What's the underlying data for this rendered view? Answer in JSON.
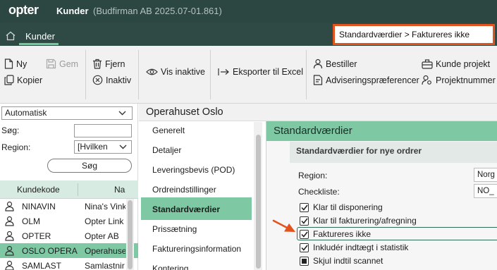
{
  "app": {
    "logo": "opter",
    "module": "Kunder",
    "company": "(Budfirman AB 2025.07-01.861)"
  },
  "nav": {
    "tab": "Kunder",
    "search_value": "Standardværdier > Faktureres ikke"
  },
  "toolbar": {
    "ny": "Ny",
    "gem": "Gem",
    "kopier": "Kopier",
    "fjern": "Fjern",
    "inaktiv": "Inaktiv",
    "vis_inaktive": "Vis inaktive",
    "eksporter": "Eksporter til Excel",
    "bestiller": "Bestiller",
    "adviseringspraeferencer": "Adviseringspræferencer",
    "kunde_projekt": "Kunde projekt",
    "projektnummer": "Projektnummer"
  },
  "left": {
    "filter_select": "Automatisk",
    "sog_label": "Søg:",
    "region_label": "Region:",
    "region_value": "[Hvilken",
    "sog_button": "Søg",
    "col_kundekode": "Kundekode",
    "col_navn": "Na",
    "rows": [
      {
        "code": "NINAVIN",
        "name": "Nina's Vink"
      },
      {
        "code": "OLM",
        "name": "Opter Link"
      },
      {
        "code": "OPTER",
        "name": "Opter AB"
      },
      {
        "code": "OSLO OPERA",
        "name": "Operahuse"
      },
      {
        "code": "SAMLAST",
        "name": "Samlastnir"
      }
    ]
  },
  "customer_title": "Operahuset Oslo",
  "menu": [
    "Generelt",
    "Detaljer",
    "Leveringsbevis (POD)",
    "Ordreindstillinger",
    "Standardværdier",
    "Prissætning",
    "Faktureringsinformation",
    "Kontering"
  ],
  "right": {
    "header": "Standardværdier",
    "subheader": "Standardværdier for nye ordrer",
    "region_label": "Region:",
    "region_value": "Norg",
    "checkliste_label": "Checkliste:",
    "checkliste_value": "NO_",
    "checkboxes": [
      {
        "label": "Klar til disponering",
        "checked": true
      },
      {
        "label": "Klar til fakturering/afregning",
        "checked": true
      },
      {
        "label": "Faktureres ikke",
        "checked": true
      },
      {
        "label": "Inkludér indtægt i statistik",
        "checked": true
      },
      {
        "label": "Skjul indtil scannet",
        "checked": "partial"
      }
    ]
  },
  "colors": {
    "titlebar": "#2c4641",
    "accent": "#7ec8a3",
    "highlight": "#e2531e"
  }
}
